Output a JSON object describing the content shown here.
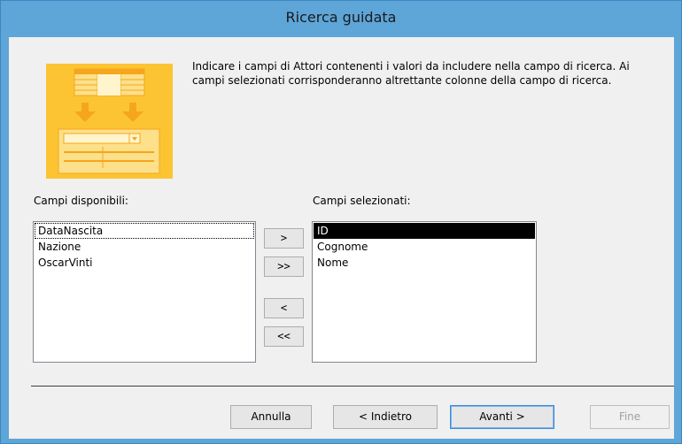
{
  "window": {
    "title": "Ricerca guidata"
  },
  "instructions": "Indicare i campi di Attori contenenti i valori da includere nella campo di ricerca. Ai campi selezionati corrisponderanno altrettante colonne della campo di ricerca.",
  "available": {
    "label": "Campi disponibili:",
    "items": [
      "DataNascita",
      "Nazione",
      "OscarVinti"
    ]
  },
  "selected": {
    "label": "Campi selezionati:",
    "items": [
      "ID",
      "Cognome",
      "Nome"
    ]
  },
  "move_buttons": {
    "add_one": ">",
    "add_all": ">>",
    "remove_one": "<",
    "remove_all": "<<"
  },
  "buttons": {
    "cancel": "Annulla",
    "back": "< Indietro",
    "next": "Avanti >",
    "finish": "Fine"
  },
  "colors": {
    "titlebar": "#5ea5d8",
    "client_bg": "#f0f0f0",
    "wizard_image": "#fcc433",
    "selection": "#000000"
  }
}
